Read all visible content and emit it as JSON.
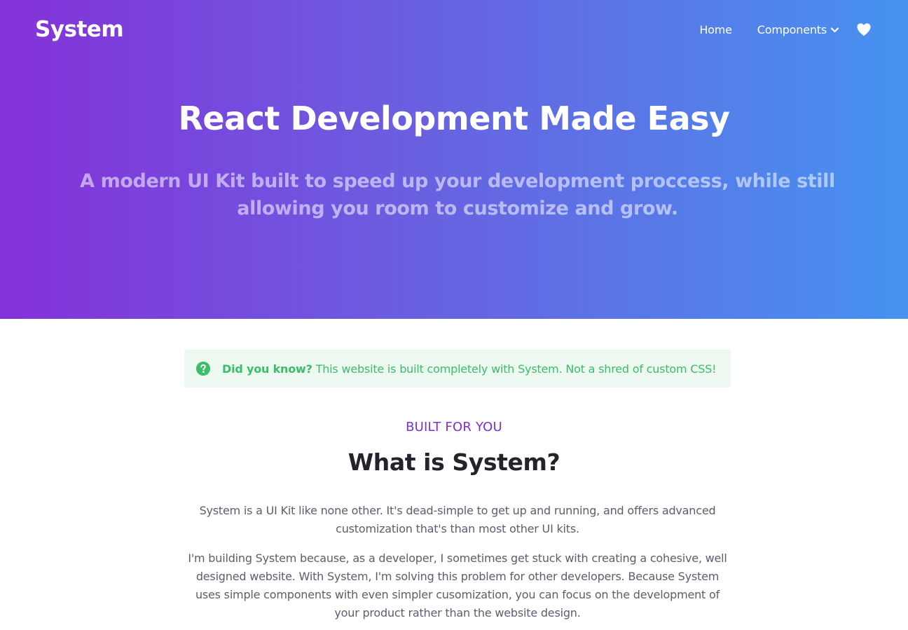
{
  "header": {
    "brand": "System",
    "nav": {
      "home": "Home",
      "components": "Components"
    },
    "icons": [
      "chevron-down-icon",
      "heart-icon"
    ]
  },
  "hero": {
    "title": "React Development Made Easy",
    "subtitle": "A modern UI Kit built to speed up your development proccess, while still allowing you room to customize and grow.",
    "gradient": [
      "#8531d9",
      "#4693ef"
    ]
  },
  "notice": {
    "icon": "question-circle-icon",
    "strong": "Did you know?",
    "text": "This website is built completely with System. Not a shred of custom CSS!",
    "color": "#3bbd6a"
  },
  "section": {
    "eyebrow": "BUILT FOR YOU",
    "title": "What is System?",
    "paragraphs": [
      "System is a UI Kit like none other. It's dead-simple to get up and running, and offers advanced customization that's than most other UI kits.",
      "I'm building System because, as a developer, I sometimes get stuck with creating a cohesive, well designed website. With System, I'm solving this problem for other developers. Because System uses simple components with even simpler cusomization, you can focus on the development of your product rather than the website design."
    ],
    "accent": "#7d2fcf"
  }
}
